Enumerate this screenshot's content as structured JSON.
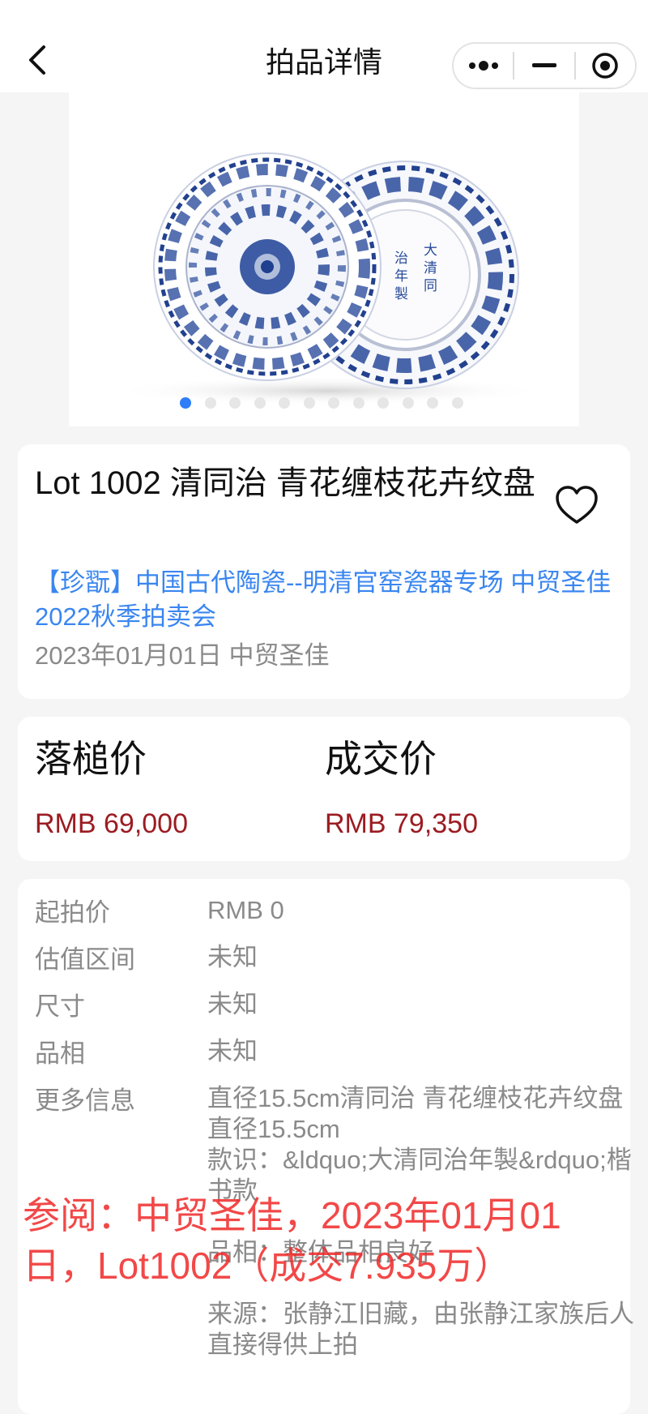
{
  "navbar": {
    "title": "拍品详情",
    "back_icon": "chevron-left-icon",
    "capsule_icons": [
      "more-dots-icon",
      "minimize-icon",
      "target-icon"
    ]
  },
  "gallery": {
    "image_count": 12,
    "active_index": 0,
    "mark_text": "大清同治年製"
  },
  "lot": {
    "title": "Lot 1002 清同治 青花缠枝花卉纹盘",
    "auction_name": "【珍翫】中国古代陶瓷--明清官窑瓷器专场 中贸圣佳2022秋季拍卖会",
    "date_house": "2023年01月01日 中贸圣佳"
  },
  "prices": {
    "hammer_label": "落槌价",
    "hammer_value": "RMB 69,000",
    "deal_label": "成交价",
    "deal_value": "RMB 79,350"
  },
  "details": {
    "rows": [
      {
        "label": "起拍价",
        "value": "RMB 0"
      },
      {
        "label": "估值区间",
        "value": "未知"
      },
      {
        "label": "尺寸",
        "value": "未知"
      },
      {
        "label": "品相",
        "value": "未知"
      }
    ],
    "more_label": "更多信息",
    "more_value": "直径15.5cm清同治 青花缠枝花卉纹盘\n直径15.5cm\n款识：&ldquo;大清同治年製&rdquo;楷书款\n\n品相：整体品相良好\n\n来源：张静江旧藏，由张静江家族后人直接得供上拍"
  },
  "watermark": "参阅：中贸圣佳，2023年01月01日，Lot1002（成交7.935万）",
  "colors": {
    "accent_blue": "#3a86f0",
    "price_red": "#9b1c22",
    "watermark_red": "#f02828",
    "porcelain_blue": "#1f3f8f"
  }
}
